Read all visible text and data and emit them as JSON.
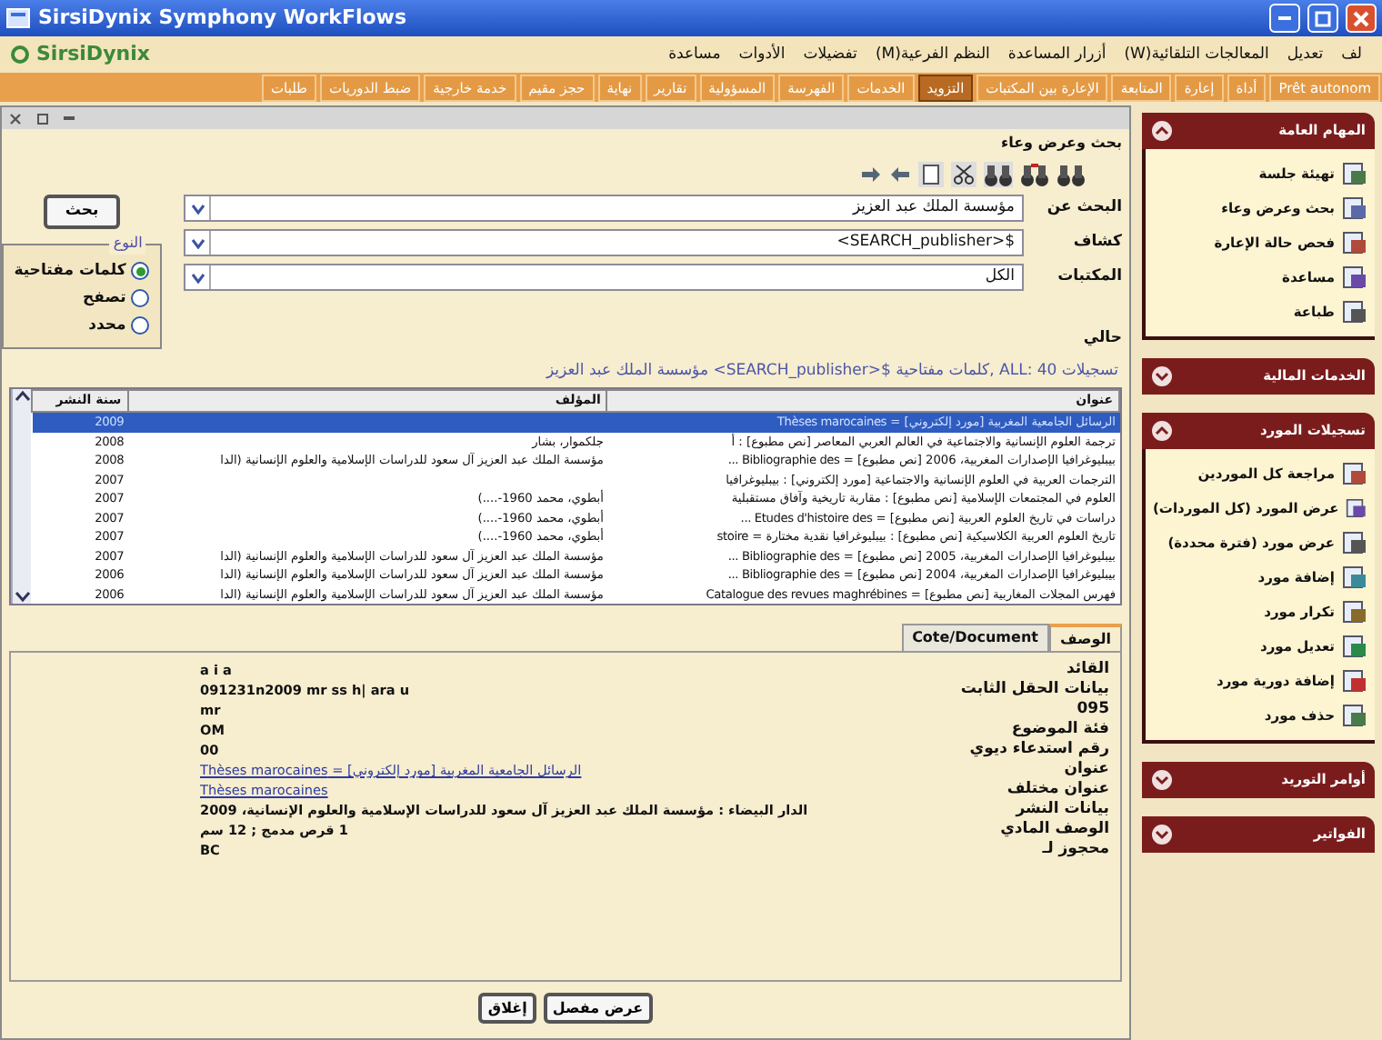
{
  "window": {
    "title": "SirsiDynix Symphony WorkFlows"
  },
  "logo": "SirsiDynix",
  "menu": [
    "لف",
    "تعديل",
    "المعالجات التلقائية(W)",
    "أزرار المساعدة",
    "النظم الفرعية(M)",
    "تفضيلات",
    "الأدوات",
    "مساعدة"
  ],
  "toolbar_tabs": [
    {
      "label": "Prêt autonom",
      "selected": false
    },
    {
      "label": "أداة",
      "selected": false
    },
    {
      "label": "إعارة",
      "selected": false
    },
    {
      "label": "المتابعة",
      "selected": false
    },
    {
      "label": "الإعارة بين المكتبات",
      "selected": false
    },
    {
      "label": "التزويد",
      "selected": true
    },
    {
      "label": "الخدمات",
      "selected": false
    },
    {
      "label": "الفهرسة",
      "selected": false
    },
    {
      "label": "المسؤولية",
      "selected": false
    },
    {
      "label": "تقارير",
      "selected": false
    },
    {
      "label": "نهاية",
      "selected": false
    },
    {
      "label": "حجز مقيم",
      "selected": false
    },
    {
      "label": "خدمة خارجية",
      "selected": false
    },
    {
      "label": "ضبط الدوريات",
      "selected": false
    },
    {
      "label": "طلبات",
      "selected": false
    }
  ],
  "search": {
    "title": "بحث وعرض وعاء",
    "fields": [
      {
        "label": "البحث عن",
        "value": "مؤسسة الملك عبد العزيز"
      },
      {
        "label": "كشاف",
        "value": "$<SEARCH_publisher>"
      },
      {
        "label": "المكتبات",
        "value": "الكل"
      }
    ],
    "search_button": "بحث",
    "type_group": "النوع",
    "type_options": [
      {
        "label": "كلمات مفتاحية",
        "selected": true
      },
      {
        "label": "تصفح",
        "selected": false
      },
      {
        "label": "محدد",
        "selected": false
      }
    ],
    "current_label": "حالي"
  },
  "results": {
    "summary": "تسجيلات 40 :ALL ,كلمات مفتاحية $<SEARCH_publisher> مؤسسة الملك عبد العزيز",
    "columns": [
      "عنوان",
      "المؤلف",
      "سنة النشر"
    ],
    "rows": [
      {
        "title": "الرسائل الجامعية المغربية [مورد إلكتروني] = Thèses marocaines",
        "author": "",
        "year": "2009",
        "selected": true
      },
      {
        "title": "ترجمة العلوم الإنسانية والاجتماعية في العالم العربي المعاصر [نص مطبوع] : أ",
        "author": "جلكموار، بشار",
        "year": "2008",
        "selected": false
      },
      {
        "title": "بيبليوغرافيا الإصدارات المغربية، 2006 [نص مطبوع] = Bibliographie des ...",
        "author": "مؤسسة الملك عبد العزيز آل سعود للدراسات الإسلامية والعلوم الإنسانية (الدا",
        "year": "2008",
        "selected": false
      },
      {
        "title": "الترجمات العربية في العلوم الإنسانية والاجتماعية [مورد إلكتروني] : بيبليوغرافيا",
        "author": "",
        "year": "2007",
        "selected": false
      },
      {
        "title": "العلوم في المجتمعات الإسلامية [نص مطبوع] : مقاربة تاريخية وآفاق مستقبلية",
        "author": "أبطوي، محمد 1960-....)",
        "year": "2007",
        "selected": false
      },
      {
        "title": "دراسات في تاريخ العلوم العربية [نص مطبوع] = Etudes d'histoire des ...",
        "author": "أبطوي، محمد 1960-....)",
        "year": "2007",
        "selected": false
      },
      {
        "title": "تاريخ العلوم العربية الكلاسيكية [نص مطبوع] : بيبليوغرافيا نقدية مختارة = stoire",
        "author": "أبطوي، محمد 1960-....)",
        "year": "2007",
        "selected": false
      },
      {
        "title": "بيبليوغرافيا الإصدارات المغربية، 2005 [نص مطبوع] = Bibliographie des ...",
        "author": "مؤسسة الملك عبد العزيز آل سعود للدراسات الإسلامية والعلوم الإنسانية (الدا",
        "year": "2007",
        "selected": false
      },
      {
        "title": "بيبليوغرافيا الإصدارات المغربية، 2004 [نص مطبوع] = Bibliographie des ...",
        "author": "مؤسسة الملك عبد العزيز آل سعود للدراسات الإسلامية والعلوم الإنسانية (الدا",
        "year": "2006",
        "selected": false
      },
      {
        "title": "فهرس المجلات المغاربية [نص مطبوع] = Catalogue des revues maghrébines",
        "author": "مؤسسة الملك عبد العزيز آل سعود للدراسات الإسلامية والعلوم الإنسانية (الدا",
        "year": "2006",
        "selected": false
      }
    ]
  },
  "detail": {
    "tabs": [
      {
        "label": "الوصف",
        "selected": true
      },
      {
        "label": "Cote/Document",
        "selected": false
      }
    ],
    "fields": [
      {
        "label": "القائد",
        "value": "a i a",
        "kind": "text"
      },
      {
        "label": "بيانات الحقل الثابت",
        "value": "091231n2009 mr ss h| ara u",
        "kind": "text"
      },
      {
        "label": "095",
        "value": "mr",
        "kind": "text"
      },
      {
        "label": "فئة الموضوع",
        "value": "OM",
        "kind": "text"
      },
      {
        "label": "رقم استدعاء ديوي",
        "value": "00",
        "kind": "text"
      },
      {
        "label": "عنوان",
        "value": "الرسائل الجامعية المغربية [مورد إلكتروني] = Thèses marocaines",
        "kind": "link"
      },
      {
        "label": "عنوان مختلف",
        "value": "Thèses marocaines",
        "kind": "link"
      },
      {
        "label": "بيانات النشر",
        "value": "الدار البيضاء : مؤسسة الملك عبد العزيز آل سعود للدراسات الإسلامية والعلوم الإنسانية، 2009",
        "kind": "text"
      },
      {
        "label": "الوصف المادي",
        "value": "1 قرص مدمج ; 12 سم",
        "kind": "text"
      },
      {
        "label": "محجوز لـ",
        "value": "BC",
        "kind": "text"
      }
    ]
  },
  "buttons": [
    "عرض مفصل",
    "إغلاق"
  ],
  "sidebar": [
    {
      "title": "المهام العامة",
      "expanded": true,
      "items": [
        "تهيئة جلسة",
        "بحث وعرض وعاء",
        "فحص حالة الإعارة",
        "مساعدة",
        "طباعة"
      ]
    },
    {
      "title": "الخدمات المالية",
      "expanded": false
    },
    {
      "title": "تسجيلات المورد",
      "expanded": true,
      "items": [
        "مراجعة كل الموردين",
        "عرض المورد (كل الموردات)",
        "عرض مورد (فترة محددة)",
        "إضافة مورد",
        "تكرار مورد",
        "تعديل مورد",
        "إضافة دورية مورد",
        "حذف مورد"
      ]
    },
    {
      "title": "أوامر التوريد",
      "expanded": false
    },
    {
      "title": "الفواتير",
      "expanded": false
    }
  ]
}
